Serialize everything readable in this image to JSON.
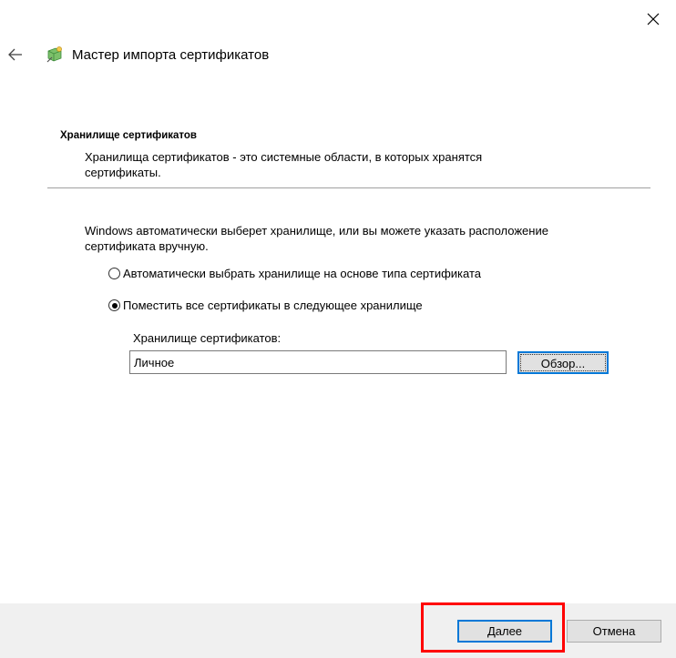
{
  "window": {
    "title": "Мастер импорта сертификатов",
    "close_icon": "close-icon",
    "back_icon": "back-arrow-icon",
    "wizard_icon": "certificate-wizard-icon"
  },
  "section": {
    "title": "Хранилище сертификатов",
    "description": "Хранилища сертификатов - это системные области, в которых хранятся сертификаты."
  },
  "body": {
    "intro": "Windows автоматически выберет хранилище, или вы можете указать расположение сертификата вручную.",
    "radio_auto": {
      "label": "Автоматически выбрать хранилище на основе типа сертификата",
      "checked": false
    },
    "radio_manual": {
      "label": "Поместить все сертификаты в следующее хранилище",
      "checked": true
    },
    "store_label": "Хранилище сертификатов:",
    "store_value": "Личное",
    "browse_label": "Обзор..."
  },
  "footer": {
    "next_label": "Далее",
    "cancel_label": "Отмена"
  },
  "colors": {
    "accent": "#0078d7",
    "highlight": "#ff0000",
    "footer_bg": "#f0f0f0"
  }
}
